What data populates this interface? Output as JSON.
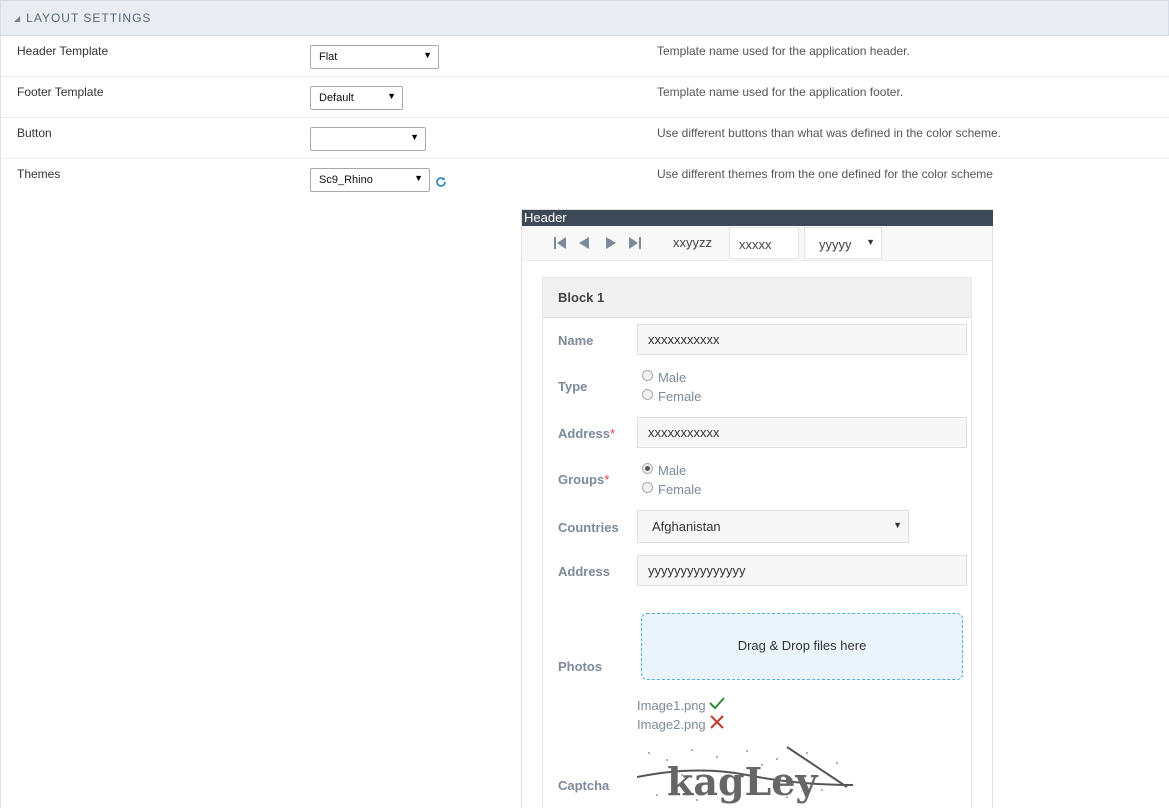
{
  "section": {
    "title": "LAYOUT SETTINGS",
    "collapse_icon": "triangle-icon"
  },
  "settings": [
    {
      "label": "Header Template",
      "value": "Flat",
      "help": "Template name used for the application header."
    },
    {
      "label": "Footer Template",
      "value": "Default",
      "help": "Template name used for the application footer."
    },
    {
      "label": "Button",
      "value": "",
      "help": "Use different buttons than what was defined in the color scheme."
    },
    {
      "label": "Themes",
      "value": "Sc9_Rhino",
      "help": "Use different themes from the one defined for the color scheme"
    }
  ],
  "preview": {
    "header_title": "Header",
    "toolbar": {
      "text": "xxyyzz",
      "input_value": "xxxxx",
      "select_value": "yyyyy"
    },
    "block_title": "Block 1",
    "fields": {
      "name": {
        "label": "Name",
        "value": "xxxxxxxxxxx"
      },
      "type": {
        "label": "Type",
        "options": [
          "Male",
          "Female"
        ]
      },
      "address1": {
        "label": "Address",
        "required": "*",
        "value": "xxxxxxxxxxx"
      },
      "groups": {
        "label": "Groups",
        "required": "*",
        "options": [
          "Male",
          "Female"
        ]
      },
      "countries": {
        "label": "Countries",
        "value": "Afghanistan"
      },
      "address2": {
        "label": "Address",
        "value": "yyyyyyyyyyyyyyy"
      },
      "photos": {
        "label": "Photos",
        "dropzone_text": "Drag & Drop files here",
        "files": [
          "Image1.png",
          "Image2.png"
        ]
      },
      "captcha": {
        "label": "Captcha",
        "text": "kagLey"
      }
    }
  },
  "colors": {
    "header_bg": "#3d4957",
    "dropzone_border": "#5aaed8",
    "success": "#2e8b3a",
    "error": "#c0392b"
  }
}
